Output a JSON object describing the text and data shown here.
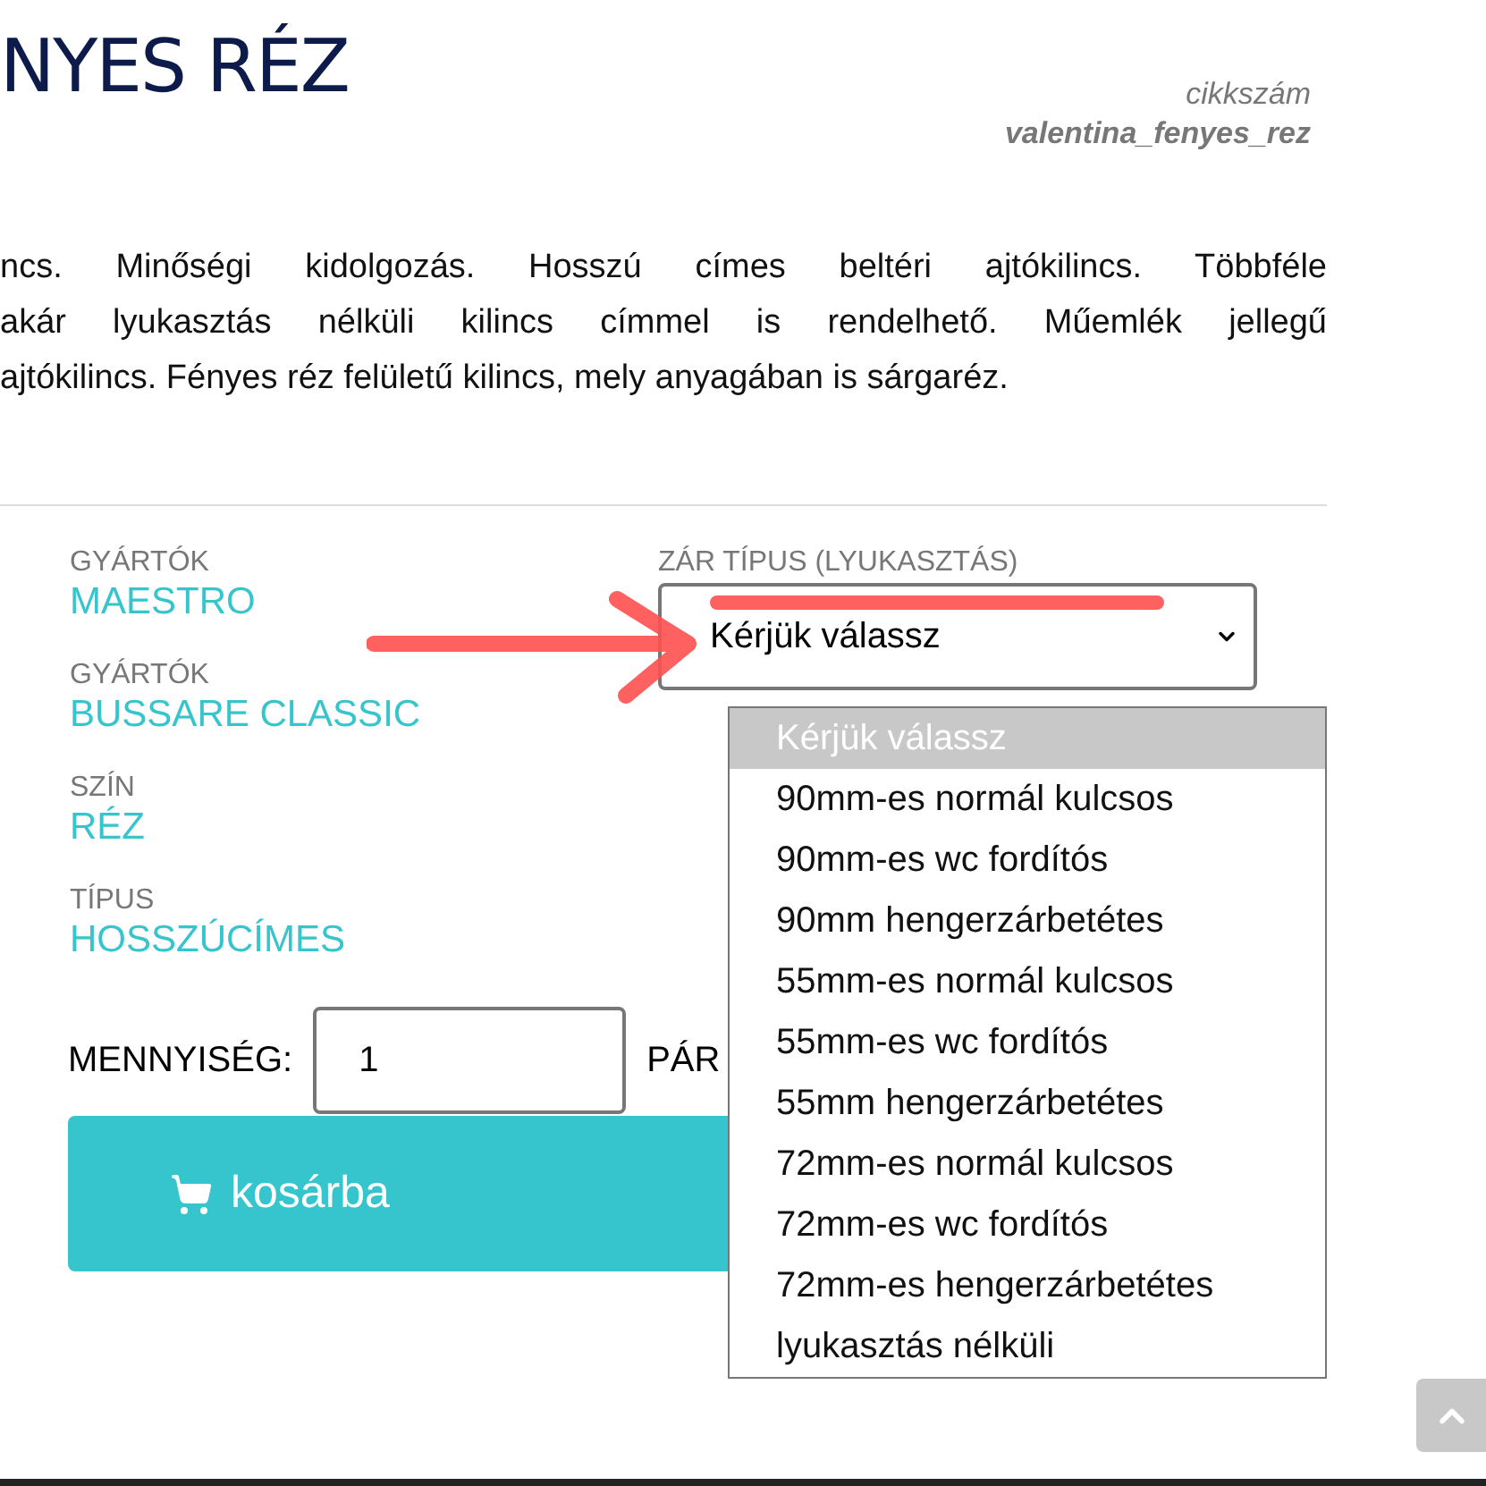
{
  "title": "NYES RÉZ",
  "sku": {
    "label": "cikkszám",
    "value": "valentina_fenyes_rez"
  },
  "description_lines": [
    "ncs. Minőségi kidolgozás. Hosszú címes beltéri ajtókilincs. Többféle",
    "akár lyukasztás nélküli kilincs címmel is rendelhető. Műemlék jellegű",
    "ajtókilincs. Fényes réz felületű kilincs, mely anyagában is sárgaréz."
  ],
  "attributes": [
    {
      "label": "GYÁRTÓK",
      "value": "MAESTRO"
    },
    {
      "label": "GYÁRTÓK",
      "value": "BUSSARE CLASSIC"
    },
    {
      "label": "SZÍN",
      "value": "RÉZ"
    },
    {
      "label": "TÍPUS",
      "value": "HOSSZÚCÍMES"
    }
  ],
  "lock_select": {
    "label": "ZÁR TÍPUS (LYUKASZTÁS)",
    "value": "Kérjük válassz",
    "expanded": true,
    "options": [
      {
        "label": "Kérjük válassz",
        "selected": true
      },
      {
        "label": "90mm-es normál kulcsos",
        "selected": false
      },
      {
        "label": "90mm-es wc fordítós",
        "selected": false
      },
      {
        "label": "90mm hengerzárbetétes",
        "selected": false
      },
      {
        "label": "55mm-es normál kulcsos",
        "selected": false
      },
      {
        "label": "55mm-es wc fordítós",
        "selected": false
      },
      {
        "label": "55mm hengerzárbetétes",
        "selected": false
      },
      {
        "label": "72mm-es normál kulcsos",
        "selected": false
      },
      {
        "label": "72mm-es wc fordítós",
        "selected": false
      },
      {
        "label": "72mm-es hengerzárbetétes",
        "selected": false
      },
      {
        "label": "lyukasztás nélküli",
        "selected": false
      }
    ]
  },
  "quantity": {
    "label": "MENNYISÉG:",
    "value": "1",
    "unit": "PÁR"
  },
  "cart_button": "kosárba"
}
